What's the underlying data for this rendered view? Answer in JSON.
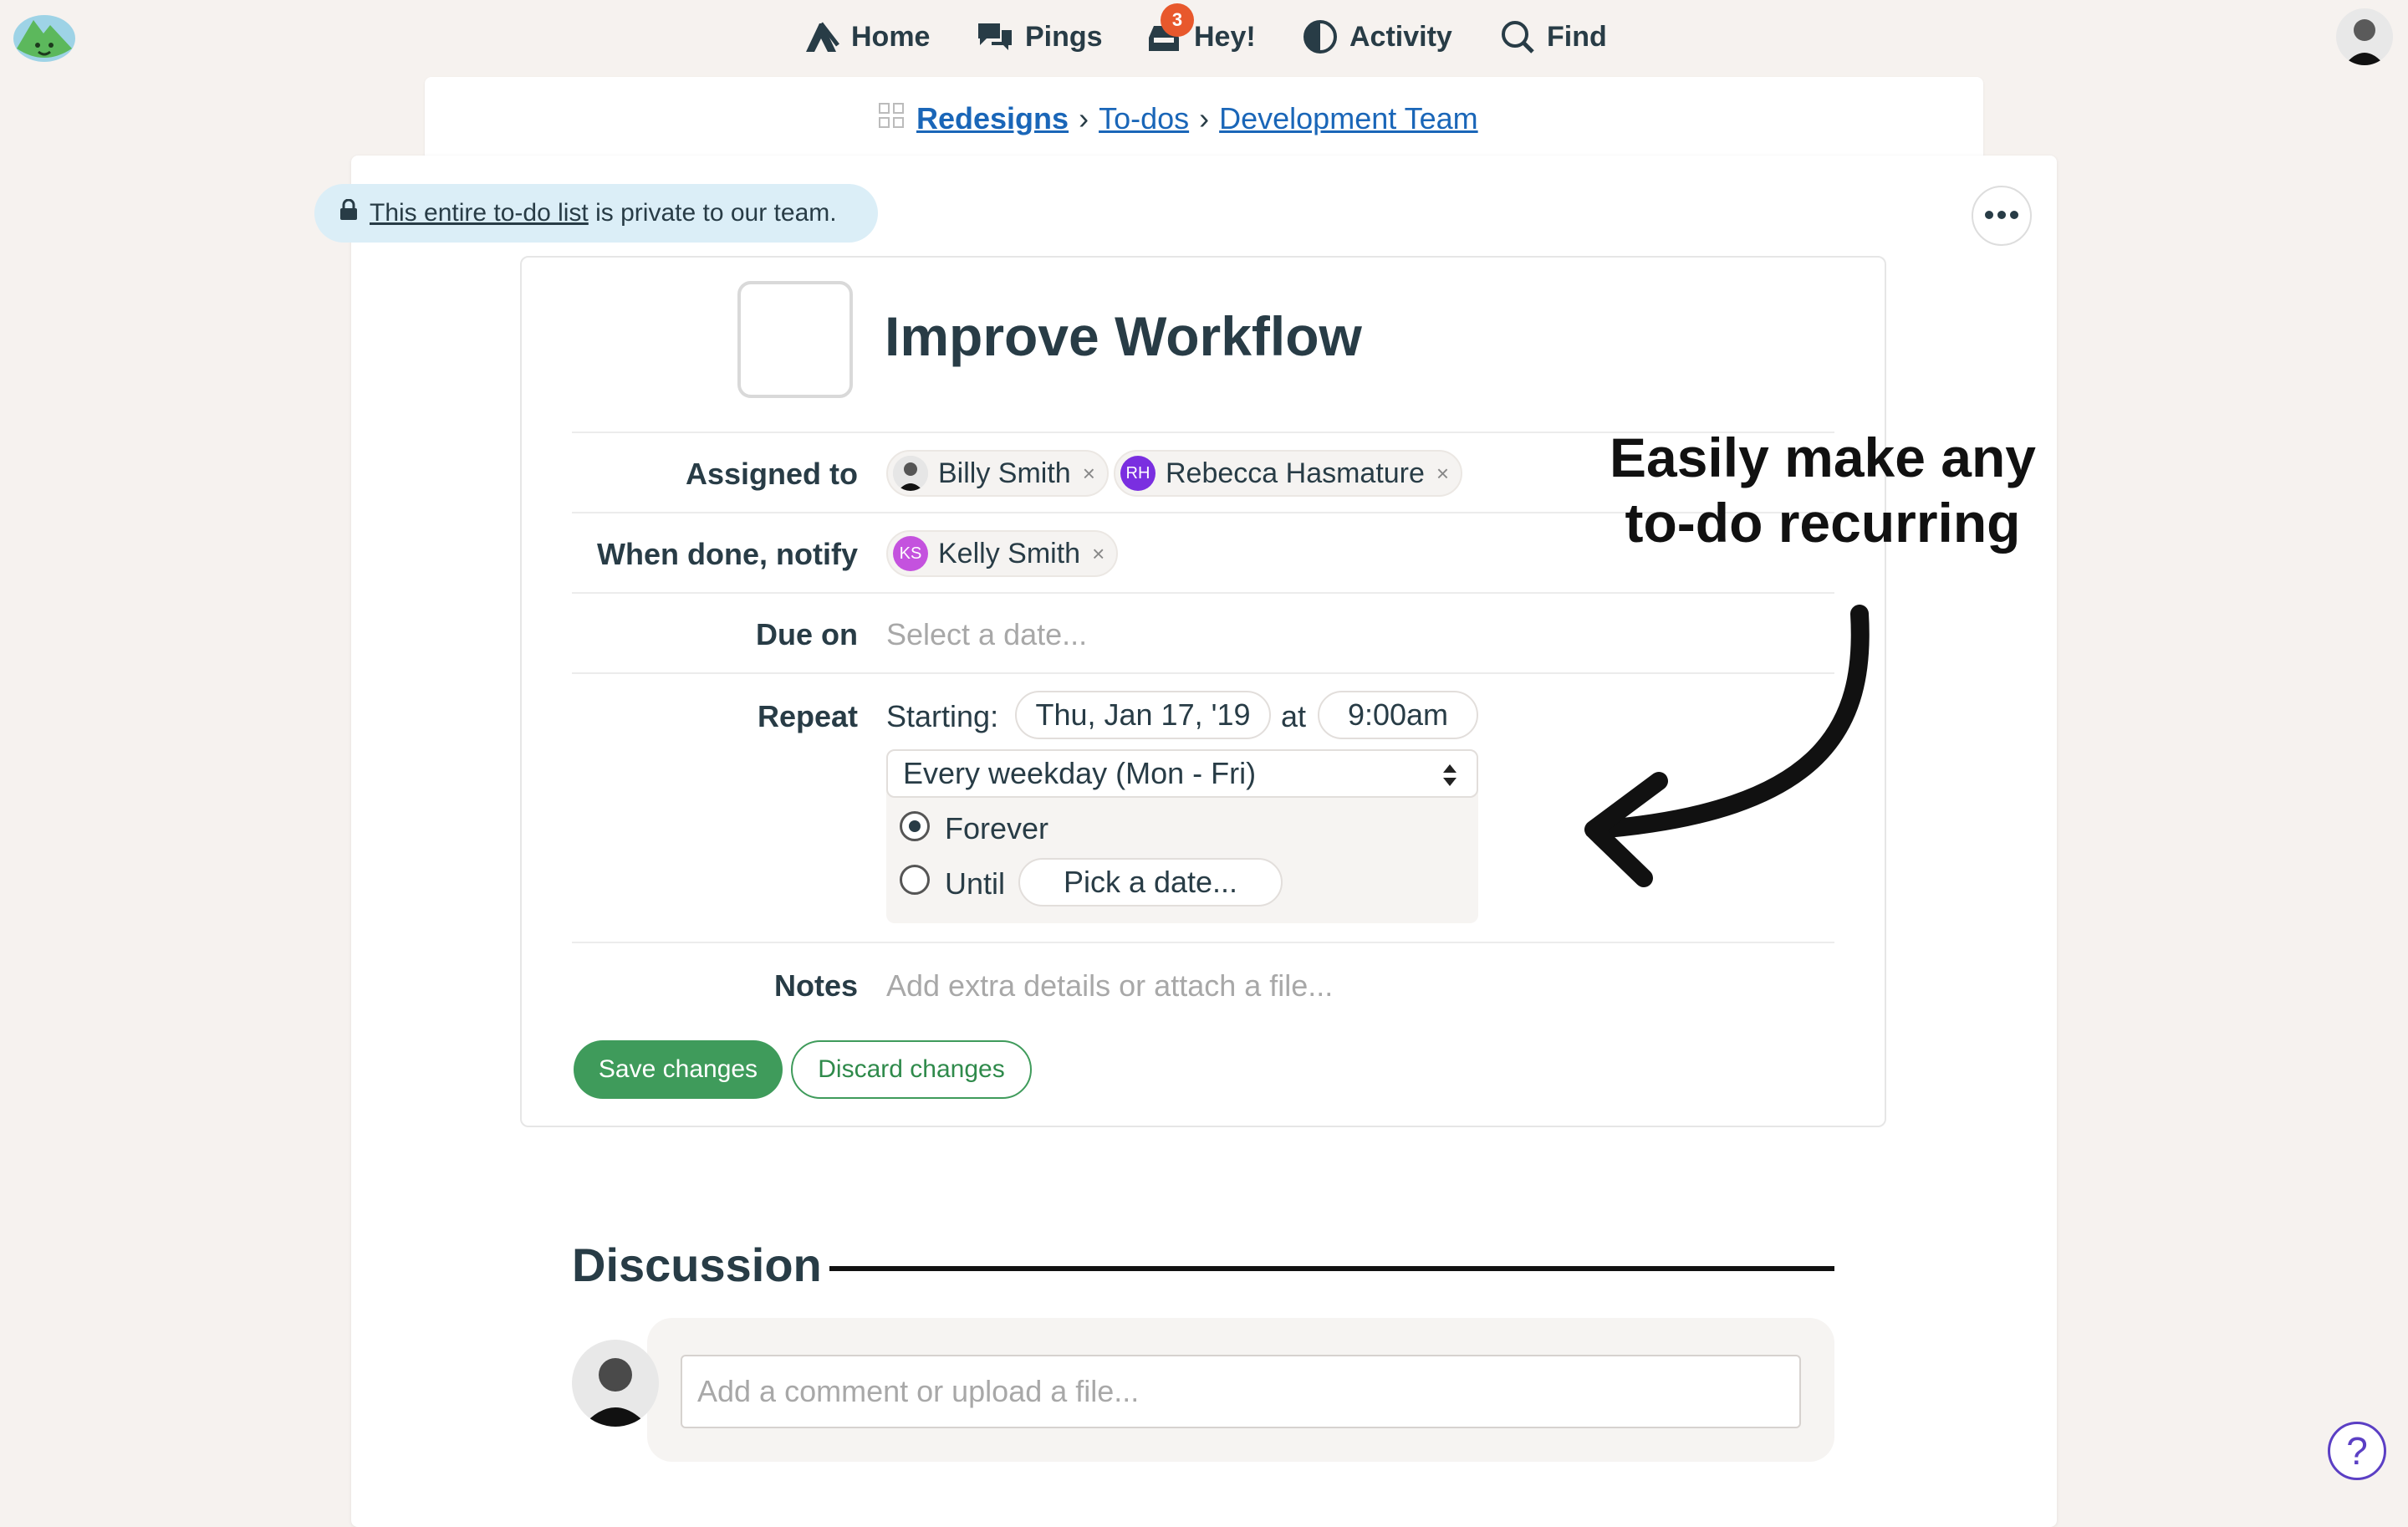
{
  "nav": {
    "items": [
      {
        "label": "Home",
        "icon": "home-tent-icon"
      },
      {
        "label": "Pings",
        "icon": "speech-bubbles-icon"
      },
      {
        "label": "Hey!",
        "icon": "inbox-bell-icon",
        "badge": "3"
      },
      {
        "label": "Activity",
        "icon": "pie-clock-icon"
      },
      {
        "label": "Find",
        "icon": "search-icon"
      }
    ]
  },
  "breadcrumb": {
    "project": "Redesigns",
    "section": "To-dos",
    "list": "Development Team",
    "separator": "›"
  },
  "privacy": {
    "link_text": "This entire to-do list",
    "rest_text": " is private to our team."
  },
  "todo": {
    "title": "Improve Workflow",
    "assigned_label": "Assigned to",
    "assignees": [
      {
        "name": "Billy Smith",
        "initials": ""
      },
      {
        "name": "Rebecca Hasmature",
        "initials": "RH",
        "color": "#7a2fe0"
      }
    ],
    "notify_label": "When done, notify",
    "notify": [
      {
        "name": "Kelly Smith",
        "initials": "KS",
        "color": "#c452de"
      }
    ],
    "due_label": "Due on",
    "due_placeholder": "Select a date...",
    "repeat_label": "Repeat",
    "starting_label": "Starting:",
    "start_date": "Thu, Jan 17, '19",
    "at_label": "at",
    "start_time": "9:00am",
    "frequency": "Every weekday (Mon - Fri)",
    "forever_label": "Forever",
    "until_label": "Until",
    "until_placeholder": "Pick a date...",
    "notes_label": "Notes",
    "notes_placeholder": "Add extra details or attach a file...",
    "save_label": "Save changes",
    "discard_label": "Discard changes"
  },
  "callout": {
    "line1": "Easily make any",
    "line2": "to-do recurring"
  },
  "discussion": {
    "title": "Discussion",
    "comment_placeholder": "Add a comment or upload a file..."
  },
  "help": {
    "label": "?"
  },
  "colors": {
    "accent_green": "#3f9b5b",
    "link_blue": "#1a66b8",
    "badge_orange": "#e8582c",
    "privacy_bg": "#dbeef7"
  }
}
